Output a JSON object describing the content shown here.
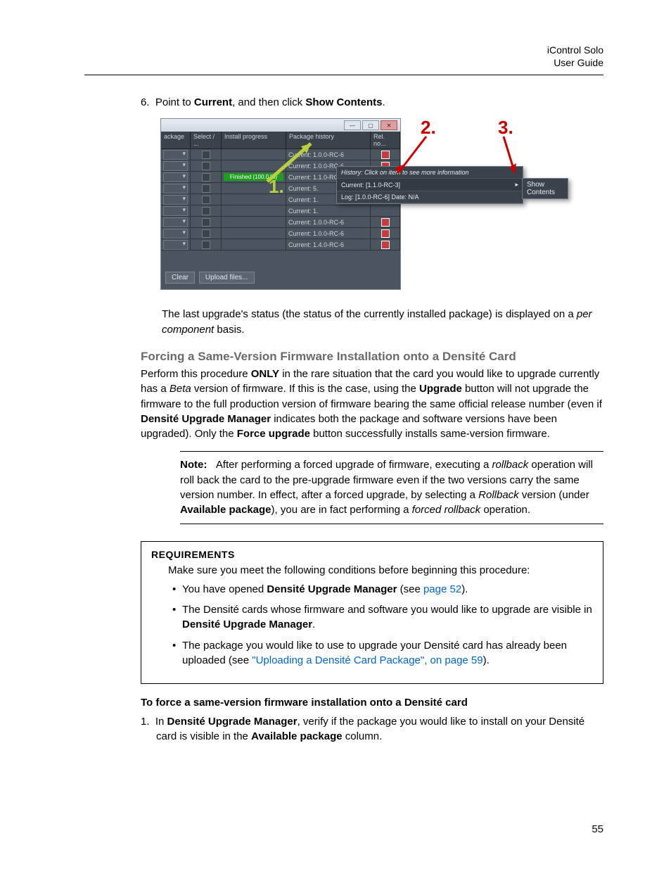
{
  "header": {
    "product": "iControl Solo",
    "subtitle": "User Guide"
  },
  "step6": {
    "num": "6.",
    "pre": "Point to ",
    "b1": "Current",
    "mid": ", and then click ",
    "b2": "Show Contents",
    "post": "."
  },
  "screenshot": {
    "cols": {
      "ackage": "ackage",
      "select": "Select / ...",
      "install": "Install progress",
      "history": "Package history",
      "rel": "Rel. no..."
    },
    "rows": [
      {
        "hist": "Current: 1.0.0-RC-6"
      },
      {
        "hist": "Current: 1.0.0-RC-6"
      },
      {
        "inst": "Finished (100.0 %)",
        "hist": "Current: 1.1.0-RC-3"
      },
      {
        "hist": "Current: 5."
      },
      {
        "hist": "Current: 1."
      },
      {
        "hist": "Current: 1."
      },
      {
        "hist": "Current: 1.0.0-RC-6"
      },
      {
        "hist": "Current: 1.0.0-RC-6"
      },
      {
        "hist": "Current: 1.4.0-RC-6"
      }
    ],
    "flyout": {
      "header": "History: Click on item to see more information",
      "current": "Current: [1.1.0-RC-3]",
      "log": "Log: [1.0.0-RC-6] Date: N/A"
    },
    "showcontents": "Show Contents",
    "clear": "Clear",
    "upload": "Upload files...",
    "callouts": {
      "one": "1.",
      "two": "2.",
      "three": "3."
    }
  },
  "afterimg": {
    "p1a": "The last upgrade's status (the status of the currently installed package) is displayed on a ",
    "p1i": "per component",
    "p1b": " basis."
  },
  "h_force": "Forcing a Same-Version Firmware Installation onto a Densité Card",
  "force_para": {
    "a": "Perform this procedure ",
    "only": "ONLY",
    "b": " in the rare situation that the card you would like to upgrade currently has a ",
    "beta": "Beta",
    "c": " version of firmware. If this is the case, using the ",
    "upgrade": "Upgrade",
    "d": " button will not upgrade the firmware to the full production version of firmware bearing the same official release number (even if ",
    "dum": "Densité Upgrade Manager",
    "e": " indicates both the package and software versions have been upgraded). Only the ",
    "fu": "Force upgrade",
    "f": " button successfully installs same-version firmware."
  },
  "note": {
    "label": "Note:",
    "a": "After performing a forced upgrade of firmware, executing a ",
    "rollback": "rollback",
    "b": " operation will roll back the card to the pre-upgrade firmware even if the two versions carry the same version number. In effect, after a forced upgrade, by selecting a ",
    "rollback2": "Rollback",
    "c": " version (under ",
    "avail": "Available package",
    "d": "), you are in fact performing a ",
    "forced": "forced rollback",
    "e": " operation."
  },
  "req": {
    "title": "REQUIREMENTS",
    "intro": "Make sure you meet the following conditions before beginning this procedure:",
    "i1a": "You have opened ",
    "i1b": "Densité Upgrade Manager",
    "i1c": " (see ",
    "i1link": "page 52",
    "i1d": ").",
    "i2a": "The Densité cards whose firmware and software you would like to upgrade are visible in ",
    "i2b": "Densité Upgrade Manager",
    "i2c": ".",
    "i3a": "The package you would like to use to upgrade your Densité card has already been uploaded (see ",
    "i3link": "\"Uploading a Densité Card Package\", on page 59",
    "i3b": ")."
  },
  "proc": {
    "title": "To force a same-version firmware installation onto a Densité card",
    "s1num": "1.",
    "s1a": "In ",
    "s1b": "Densité Upgrade Manager",
    "s1c": ", verify if the package you would like to install on your Densité card is visible in the ",
    "s1d": "Available package",
    "s1e": " column."
  },
  "pagenum": "55"
}
